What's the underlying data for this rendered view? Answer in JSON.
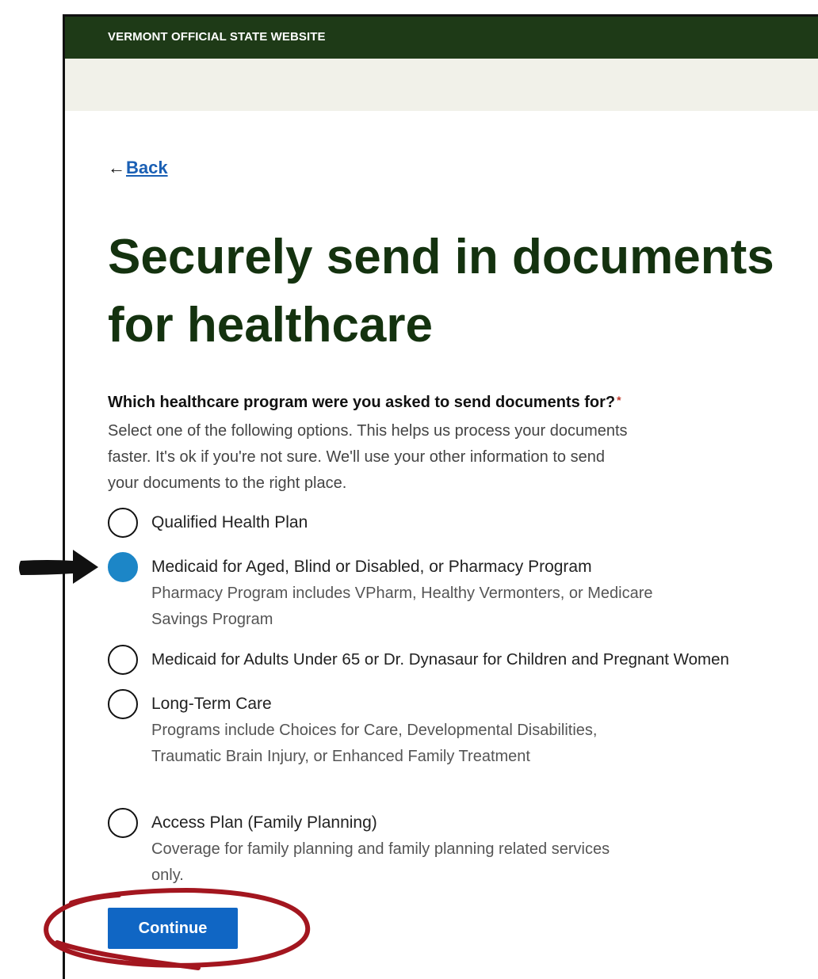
{
  "banner": {
    "text": "VERMONT OFFICIAL STATE WEBSITE"
  },
  "nav": {
    "back_arrow": "←",
    "back_label": "Back"
  },
  "page": {
    "title": "Securely send in documents for healthcare"
  },
  "form": {
    "question": "Which healthcare program were you asked to send documents for?",
    "required_mark": "*",
    "help_text": "Select one of the following options. This helps us process your documents faster. It's ok if you're not sure. We'll use your other information to send your documents to the right place.",
    "options": [
      {
        "label": "Qualified Health Plan",
        "description": "",
        "selected": false
      },
      {
        "label": "Medicaid for Aged, Blind or Disabled, or Pharmacy Program",
        "description": "Pharmacy Program includes VPharm, Healthy Vermonters, or Medicare Savings Program",
        "selected": true
      },
      {
        "label": "Medicaid for Adults Under 65 or Dr. Dynasaur for Children and Pregnant Women",
        "description": "",
        "selected": false
      },
      {
        "label": "Long-Term Care",
        "description": "Programs include Choices for Care, Developmental Disabilities, Traumatic Brain Injury, or Enhanced Family Treatment",
        "selected": false
      },
      {
        "label": "Access Plan (Family Planning)",
        "description": "Coverage for family planning and family planning related services only.",
        "selected": false
      }
    ],
    "continue_label": "Continue"
  },
  "colors": {
    "banner": "#1e3a17",
    "title": "#14320f",
    "link": "#1a5fb4",
    "radio_selected": "#1c86c7",
    "button": "#1066c4",
    "annotation": "#a3161f"
  },
  "annotations": [
    {
      "type": "arrow-icon",
      "target": "option-medicaid-aged-blind-disabled"
    },
    {
      "type": "circle-highlight",
      "target": "continue-button"
    }
  ]
}
